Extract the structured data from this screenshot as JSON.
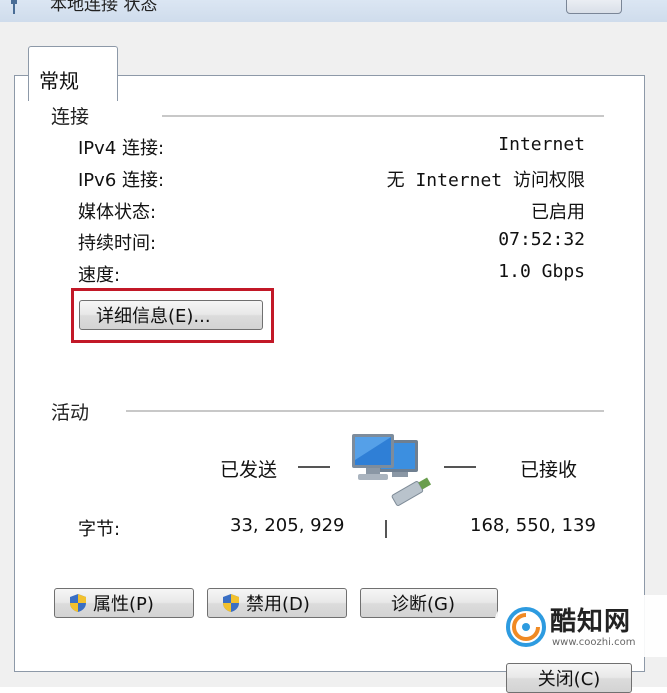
{
  "window": {
    "title": "本地连接 状态"
  },
  "tabs": [
    {
      "label": "常规"
    }
  ],
  "connection": {
    "group_title": "连接",
    "rows": [
      {
        "label": "IPv4 连接:",
        "value": "Internet"
      },
      {
        "label": "IPv6 连接:",
        "value_prefix": "无",
        "value_mid": "Internet",
        "value_suffix": "访问权限"
      },
      {
        "label": "媒体状态:",
        "value": "已启用"
      },
      {
        "label": "持续时间:",
        "value": "07:52:32"
      },
      {
        "label": "速度:",
        "value": "1.0 Gbps"
      }
    ],
    "details_button": "详细信息(E)..."
  },
  "activity": {
    "group_title": "活动",
    "sent_label": "已发送",
    "received_label": "已接收",
    "bytes_label": "字节:",
    "bytes_sent": "33, 205, 929",
    "bytes_received": "168, 550, 139"
  },
  "buttons": {
    "properties": "属性(P)",
    "disable": "禁用(D)",
    "diagnose": "诊断(G)",
    "close": "关闭(C)"
  },
  "watermark": {
    "name": "酷知网",
    "url": "www.coozhi.com"
  },
  "colors": {
    "highlight": "#c21827",
    "panel_border": "#8d99a8"
  }
}
